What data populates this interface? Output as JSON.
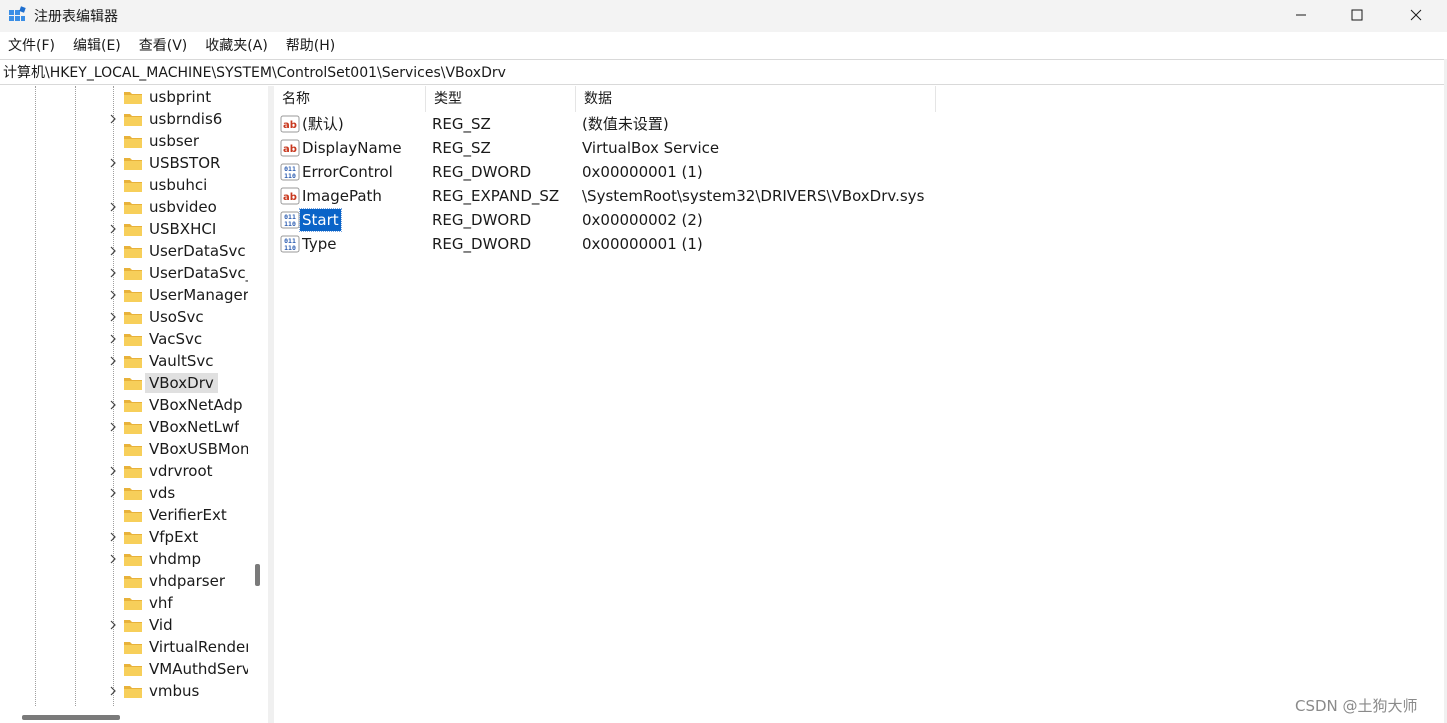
{
  "window": {
    "title": "注册表编辑器",
    "controls": {
      "minimize": "minimize-icon",
      "maximize": "maximize-icon",
      "close": "close-icon"
    }
  },
  "menu": [
    "文件(F)",
    "编辑(E)",
    "查看(V)",
    "收藏夹(A)",
    "帮助(H)"
  ],
  "address": "计算机\\HKEY_LOCAL_MACHINE\\SYSTEM\\ControlSet001\\Services\\VBoxDrv",
  "tree": {
    "items": [
      {
        "label": "usbprint",
        "expandable": false
      },
      {
        "label": "usbrndis6",
        "expandable": true
      },
      {
        "label": "usbser",
        "expandable": false
      },
      {
        "label": "USBSTOR",
        "expandable": true
      },
      {
        "label": "usbuhci",
        "expandable": false
      },
      {
        "label": "usbvideo",
        "expandable": true
      },
      {
        "label": "USBXHCI",
        "expandable": true
      },
      {
        "label": "UserDataSvc",
        "expandable": true
      },
      {
        "label": "UserDataSvc_",
        "expandable": true
      },
      {
        "label": "UserManager",
        "expandable": true
      },
      {
        "label": "UsoSvc",
        "expandable": true
      },
      {
        "label": "VacSvc",
        "expandable": true
      },
      {
        "label": "VaultSvc",
        "expandable": true
      },
      {
        "label": "VBoxDrv",
        "expandable": false,
        "selected": true
      },
      {
        "label": "VBoxNetAdp",
        "expandable": true
      },
      {
        "label": "VBoxNetLwf",
        "expandable": true
      },
      {
        "label": "VBoxUSBMon",
        "expandable": false
      },
      {
        "label": "vdrvroot",
        "expandable": true
      },
      {
        "label": "vds",
        "expandable": true
      },
      {
        "label": "VerifierExt",
        "expandable": false
      },
      {
        "label": "VfpExt",
        "expandable": true
      },
      {
        "label": "vhdmp",
        "expandable": true
      },
      {
        "label": "vhdparser",
        "expandable": false
      },
      {
        "label": "vhf",
        "expandable": false
      },
      {
        "label": "Vid",
        "expandable": true
      },
      {
        "label": "VirtualRender",
        "expandable": false
      },
      {
        "label": "VMAuthdServ",
        "expandable": false
      },
      {
        "label": "vmbus",
        "expandable": true
      }
    ]
  },
  "list": {
    "columns": [
      "名称",
      "类型",
      "数据"
    ],
    "rows": [
      {
        "icon": "string-value-icon",
        "name": "(默认)",
        "type": "REG_SZ",
        "data": "(数值未设置)"
      },
      {
        "icon": "string-value-icon",
        "name": "DisplayName",
        "type": "REG_SZ",
        "data": "VirtualBox Service"
      },
      {
        "icon": "binary-value-icon",
        "name": "ErrorControl",
        "type": "REG_DWORD",
        "data": "0x00000001 (1)"
      },
      {
        "icon": "string-value-icon",
        "name": "ImagePath",
        "type": "REG_EXPAND_SZ",
        "data": "\\SystemRoot\\system32\\DRIVERS\\VBoxDrv.sys"
      },
      {
        "icon": "binary-value-icon",
        "name": "Start",
        "type": "REG_DWORD",
        "data": "0x00000002 (2)",
        "selected": true
      },
      {
        "icon": "binary-value-icon",
        "name": "Type",
        "type": "REG_DWORD",
        "data": "0x00000001 (1)"
      }
    ]
  },
  "watermark": "CSDN @土狗大师",
  "colors": {
    "selection_blue": "#0a64c8",
    "tree_selection": "#e0e0e0",
    "folder_yellow": "#f5c542",
    "string_icon_red": "#c8381e",
    "binary_icon_blue": "#2a5bb0"
  }
}
